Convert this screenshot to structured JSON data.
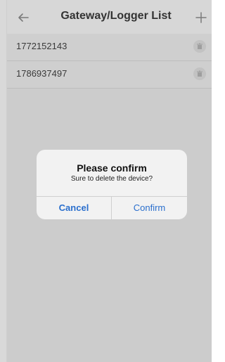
{
  "header": {
    "title": "Gateway/Logger List"
  },
  "devices": [
    {
      "id": "1772152143"
    },
    {
      "id": "1786937497"
    }
  ],
  "dialog": {
    "title": "Please confirm",
    "message": "Sure to delete the device?",
    "cancel_label": "Cancel",
    "confirm_label": "Confirm"
  },
  "icons": {
    "back": "arrow-left-icon",
    "add": "plus-icon",
    "delete": "trash-icon"
  },
  "colors": {
    "accent": "#2a6fcd",
    "overlay": "#cfcfcf",
    "dialog_bg": "#f2f2f2"
  }
}
